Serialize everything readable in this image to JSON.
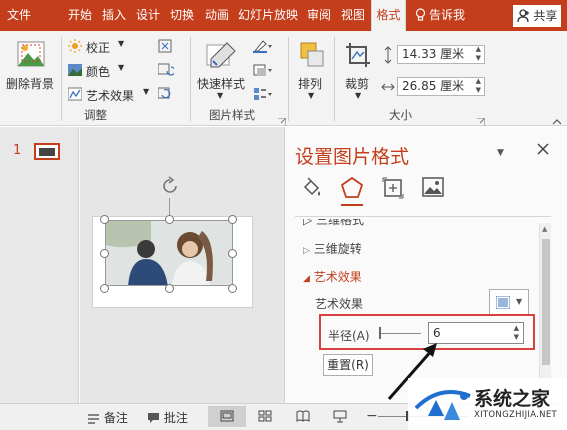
{
  "tabs": [
    {
      "label": "文件"
    },
    {
      "label": "开始"
    },
    {
      "label": "插入"
    },
    {
      "label": "设计"
    },
    {
      "label": "切换"
    },
    {
      "label": "动画"
    },
    {
      "label": "幻灯片放映"
    },
    {
      "label": "审阅"
    },
    {
      "label": "视图"
    },
    {
      "label": "格式",
      "active": true
    }
  ],
  "tell_me": "告诉我",
  "share": "共享",
  "ribbon": {
    "remove_bg": "删除背景",
    "correct": "校正",
    "color": "颜色",
    "artistic": "艺术效果",
    "group_adjust": "调整",
    "quick_styles": "快速样式",
    "group_styles": "图片样式",
    "arrange": "排列",
    "crop": "裁剪",
    "height": "14.33 厘米",
    "width": "26.85 厘米",
    "group_size": "大小"
  },
  "slide_number": "1",
  "pane": {
    "title": "设置图片格式",
    "cut_item": "三维格式",
    "rotation_item": "三维旋转",
    "section": "艺术效果",
    "effect_label": "艺术效果",
    "radius_label": "半径(A)",
    "radius_value": "6",
    "reset": "重置(R)"
  },
  "status": {
    "notes": "备注",
    "comments": "批注"
  },
  "watermark": {
    "name": "系统之家",
    "url": "XITONGZHIJIA.NET"
  },
  "colors": {
    "accent": "#c43e1c",
    "highlight": "#d9413f"
  }
}
